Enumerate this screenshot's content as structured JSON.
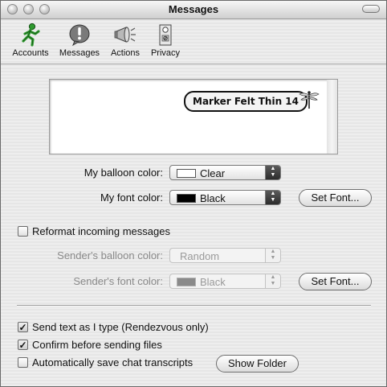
{
  "window": {
    "title": "Messages"
  },
  "toolbar": {
    "items": [
      {
        "label": "Accounts",
        "icon": "accounts-running-man-icon"
      },
      {
        "label": "Messages",
        "icon": "messages-exclamation-icon"
      },
      {
        "label": "Actions",
        "icon": "actions-megaphone-icon"
      },
      {
        "label": "Privacy",
        "icon": "privacy-doorhanger-icon"
      }
    ]
  },
  "preview": {
    "balloon_text": "Marker Felt Thin 14",
    "icon": "dragonfly-icon"
  },
  "my_balloon": {
    "label": "My balloon color:",
    "value": "Clear",
    "swatch_color": "#ffffff"
  },
  "my_font": {
    "label": "My font color:",
    "value": "Black",
    "swatch_color": "#000000",
    "set_font_label": "Set Font..."
  },
  "reformat": {
    "label": "Reformat incoming messages",
    "checked": false
  },
  "sender_balloon": {
    "label": "Sender's balloon color:",
    "value": "Random"
  },
  "sender_font": {
    "label": "Sender's font color:",
    "value": "Black",
    "swatch_color": "#8a8a8a",
    "set_font_label": "Set Font..."
  },
  "options": [
    {
      "label": "Send text as I type (Rendezvous only)",
      "checked": true
    },
    {
      "label": "Confirm before sending files",
      "checked": true
    },
    {
      "label": "Automatically save chat transcripts",
      "checked": false
    }
  ],
  "show_folder_label": "Show Folder"
}
